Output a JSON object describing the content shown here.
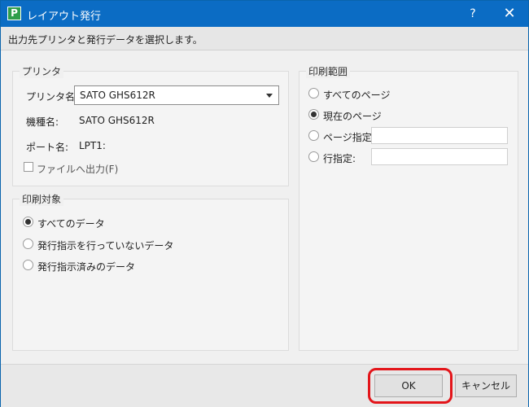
{
  "window": {
    "title": "レイアウト発行",
    "help": "?",
    "close": "✕",
    "app_icon_letter": "P"
  },
  "instruction": "出力先プリンタと発行データを選択します。",
  "printer": {
    "group_label": "プリンタ",
    "name_label": "プリンタ名:",
    "name_value": "SATO GHS612R",
    "model_label": "機種名:",
    "model_value": "SATO GHS612R",
    "port_label": "ポート名:",
    "port_value": "LPT1:",
    "file_output_label": "ファイルへ出力(F)"
  },
  "print_target": {
    "group_label": "印刷対象",
    "options": [
      "すべてのデータ",
      "発行指示を行っていないデータ",
      "発行指示済みのデータ"
    ],
    "selected_index": 0
  },
  "print_range": {
    "group_label": "印刷範囲",
    "all_pages": "すべてのページ",
    "current_page": "現在のページ",
    "page_spec": "ページ指定:",
    "line_spec": "行指定:",
    "selected": "current_page"
  },
  "buttons": {
    "ok": "OK",
    "cancel": "キャンセル"
  },
  "colors": {
    "titlebar": "#0b6cc4",
    "highlight": "#e3151a",
    "app_icon": "#2f9e4a"
  }
}
